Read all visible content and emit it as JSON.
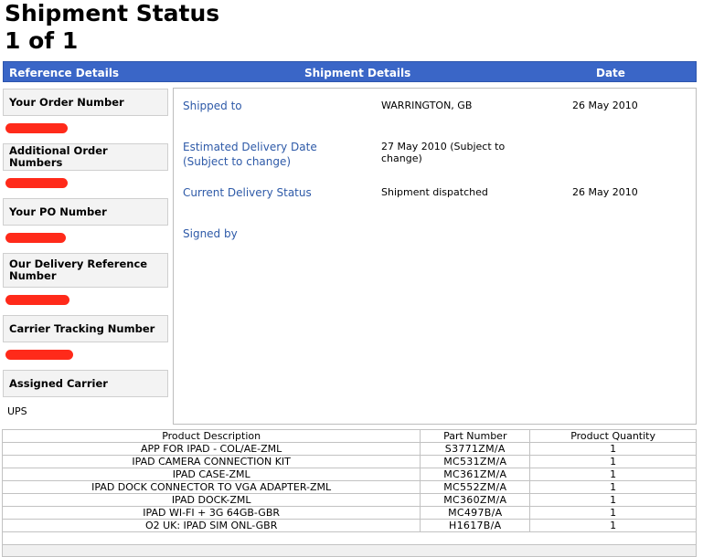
{
  "page": {
    "title": "Shipment Status",
    "page_count": "1 of 1"
  },
  "columns": {
    "reference": "Reference Details",
    "shipment": "Shipment Details",
    "date": "Date"
  },
  "reference": {
    "order_number_label": "Your Order Number",
    "additional_orders_label": "Additional Order Numbers",
    "po_number_label": "Your PO Number",
    "delivery_ref_label": "Our Delivery Reference Number",
    "tracking_label": "Carrier Tracking Number",
    "carrier_label": "Assigned Carrier",
    "carrier_value": "UPS",
    "redaction_color": "#ff2a1a"
  },
  "shipment": {
    "shipped_to_label": "Shipped to",
    "shipped_to_value": "WARRINGTON, GB",
    "shipped_to_date": "26 May 2010",
    "est_delivery_label": "Estimated Delivery Date (Subject to change)",
    "est_delivery_value": "27 May 2010 (Subject to change)",
    "status_label": "Current Delivery Status",
    "status_value": "Shipment dispatched",
    "status_date": "26 May 2010",
    "signed_by_label": "Signed by"
  },
  "products": {
    "headers": {
      "description": "Product Description",
      "part_number": "Part Number",
      "quantity": "Product Quantity"
    },
    "rows": [
      {
        "description": "APP FOR IPAD - COL/AE-ZML",
        "part_number": "S3771ZM/A",
        "quantity": "1"
      },
      {
        "description": "IPAD CAMERA CONNECTION KIT",
        "part_number": "MC531ZM/A",
        "quantity": "1"
      },
      {
        "description": "IPAD CASE-ZML",
        "part_number": "MC361ZM/A",
        "quantity": "1"
      },
      {
        "description": "IPAD DOCK CONNECTOR TO VGA ADAPTER-ZML",
        "part_number": "MC552ZM/A",
        "quantity": "1"
      },
      {
        "description": "IPAD DOCK-ZML",
        "part_number": "MC360ZM/A",
        "quantity": "1"
      },
      {
        "description": "IPAD WI-FI + 3G 64GB-GBR",
        "part_number": "MC497B/A",
        "quantity": "1"
      },
      {
        "description": "O2 UK: IPAD SIM ONL-GBR",
        "part_number": "H1617B/A",
        "quantity": "1"
      }
    ]
  },
  "colors": {
    "header_bar": "#3a66c7",
    "label_blue": "#2e5aa8"
  }
}
